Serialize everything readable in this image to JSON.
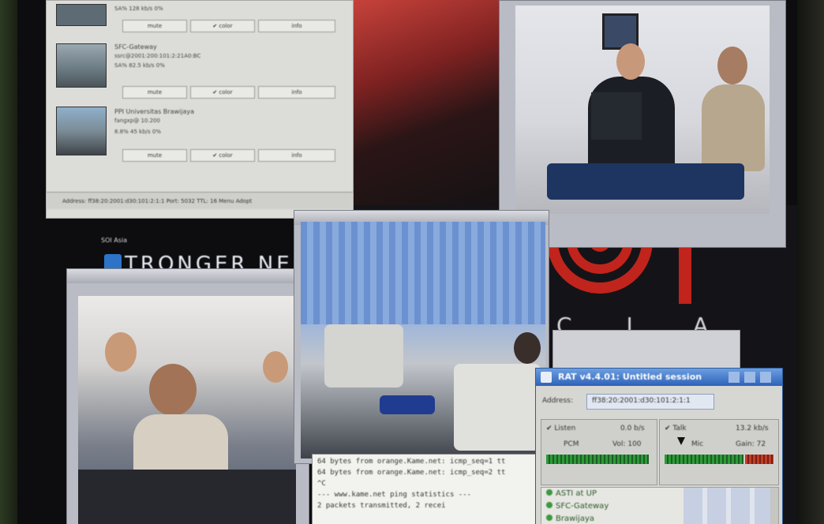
{
  "participant_list": {
    "rows": [
      {
        "line1": "SA%  128 kb/s  0%",
        "line2": "",
        "buttons": [
          "mute",
          "✔ color",
          "info"
        ]
      },
      {
        "name": "SFC-Gateway",
        "address": "ssrc@2001:200:101:2:21A0:BC",
        "stats": "SA%  82.5 kb/s  0%",
        "buttons": [
          "mute",
          "✔ color",
          "info"
        ]
      },
      {
        "name": "PPI Universitas Brawijaya",
        "address": "fangxp@ 10.200",
        "stats": "8.8%  45 kb/s  0%",
        "buttons": [
          "mute",
          "✔ color",
          "info"
        ]
      }
    ],
    "status": "Address: ff38:20:2001:d30:101:2:1:1  Port: 5032  TTL: 16  Menu  Adopt"
  },
  "soi_label": "SOI Asia",
  "banner_text": "TRONGER NE",
  "asti_letters": "C   L   A",
  "terminal": {
    "lines": [
      "64 bytes from orange.Kame.net: icmp_seq=1 tt",
      "64 bytes from orange.Kame.net: icmp_seq=2 tt",
      "^C",
      "--- www.kame.net ping statistics ---",
      "2 packets transmitted, 2 recei"
    ]
  },
  "rat": {
    "title": "RAT v4.4.01: Untitled session",
    "address_label": "Address:",
    "address_value": "ff38:20:2001:d30:101:2:1:1",
    "listen_label": "✔ Listen",
    "listen_rate": "0.0 b/s",
    "pcm_label": "PCM",
    "vol_label": "Vol: 100",
    "talk_label": "✔ Talk",
    "talk_rate": "13.2 kb/s",
    "mic_label": "Mic",
    "gain_label": "Gain: 72",
    "sites": [
      "ASTI at UP",
      "SFC-Gateway",
      "Brawijaya"
    ]
  },
  "colors": {
    "rat_title_bar": "#2e62b8",
    "meter_green": "#2d9a3a",
    "asti_red": "#c0241c",
    "banner_blue": "#2d74c8"
  }
}
